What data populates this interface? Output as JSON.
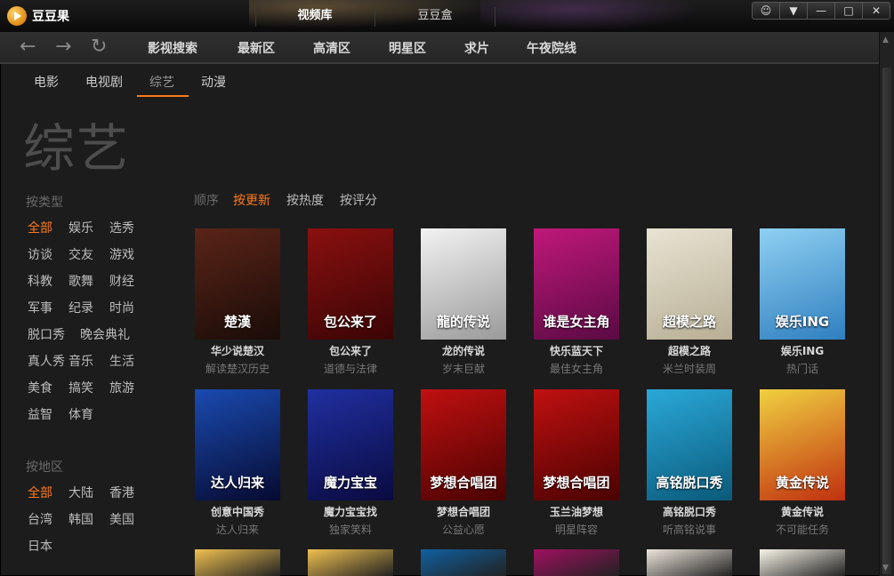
{
  "app": {
    "logo_text": "豆豆果"
  },
  "top_tabs": [
    {
      "label": "视频库",
      "active": true
    },
    {
      "label": "豆豆盒",
      "active": false
    }
  ],
  "window_buttons": [
    "speech-bubble-icon",
    "chevron-down-icon",
    "minimize-icon",
    "maximize-icon",
    "close-icon"
  ],
  "nav": {
    "items": [
      "影视搜索",
      "最新区",
      "高清区",
      "明星区",
      "求片",
      "午夜院线"
    ]
  },
  "subnav": {
    "items": [
      "电影",
      "电视剧",
      "综艺",
      "动漫"
    ],
    "active": "综艺"
  },
  "page_title": "综艺",
  "filters": {
    "type_heading": "按类型",
    "types": [
      [
        "全部",
        "娱乐",
        "选秀"
      ],
      [
        "访谈",
        "交友",
        "游戏"
      ],
      [
        "科教",
        "歌舞",
        "财经"
      ],
      [
        "军事",
        "纪录",
        "时尚"
      ],
      [
        "脱口秀",
        "晚会典礼"
      ],
      [
        "真人秀",
        "音乐",
        "生活"
      ],
      [
        "美食",
        "搞笑",
        "旅游"
      ],
      [
        "益智",
        "体育"
      ]
    ],
    "region_heading": "按地区",
    "regions": [
      [
        "全部",
        "大陆",
        "香港"
      ],
      [
        "台湾",
        "韩国",
        "美国"
      ],
      [
        "日本"
      ]
    ]
  },
  "sort": {
    "label": "顺序",
    "options": [
      "按更新",
      "按热度",
      "按评分"
    ],
    "active": "按更新"
  },
  "shows": [
    {
      "title": "华少说楚汉",
      "subtitle": "解读楚汉历史",
      "poster_text": "楚漢",
      "color1": "#5a2418",
      "color2": "#1a0c08"
    },
    {
      "title": "包公来了",
      "subtitle": "道德与法律",
      "poster_text": "包公来了",
      "color1": "#8a1010",
      "color2": "#3a0505"
    },
    {
      "title": "龙的传说",
      "subtitle": "岁末巨献",
      "poster_text": "龍的传说",
      "color1": "#f2f2f2",
      "color2": "#9a9a9a"
    },
    {
      "title": "快乐蓝天下",
      "subtitle": "最佳女主角",
      "poster_text": "谁是女主角",
      "color1": "#c0187a",
      "color2": "#5a0a44"
    },
    {
      "title": "超模之路",
      "subtitle": "米兰时装周",
      "poster_text": "超模之路",
      "color1": "#e8e3d3",
      "color2": "#b7ae94"
    },
    {
      "title": "娱乐ING",
      "subtitle": "热门话",
      "poster_text": "娱乐ING",
      "color1": "#8fd0f2",
      "color2": "#2f7fbf"
    },
    {
      "title": "创意中国秀",
      "subtitle": "达人归来",
      "poster_text": "达人归来",
      "color1": "#1a4ab0",
      "color2": "#060a30"
    },
    {
      "title": "魔力宝宝找",
      "subtitle": "独家笑料",
      "poster_text": "魔力宝宝",
      "color1": "#2030a0",
      "color2": "#0a0a40"
    },
    {
      "title": "梦想合唱团",
      "subtitle": "公益心愿",
      "poster_text": "梦想合唱团",
      "color1": "#c01010",
      "color2": "#4a0202"
    },
    {
      "title": "玉兰油梦想",
      "subtitle": "明星阵容",
      "poster_text": "梦想合唱团",
      "color1": "#c01010",
      "color2": "#4a0202"
    },
    {
      "title": "高铭脱口秀",
      "subtitle": "听高铭说事",
      "poster_text": "高铭脱口秀",
      "color1": "#2aa8d8",
      "color2": "#0a5a7a"
    },
    {
      "title": "黄金传说",
      "subtitle": "不可能任务",
      "poster_text": "黄金传说",
      "color1": "#f0d040",
      "color2": "#c03010"
    }
  ],
  "partial_row_colors": [
    "#f0c050",
    "#f0c050",
    "#1060a0",
    "#a01060",
    "#eee6dc",
    "#f8f4e8"
  ]
}
